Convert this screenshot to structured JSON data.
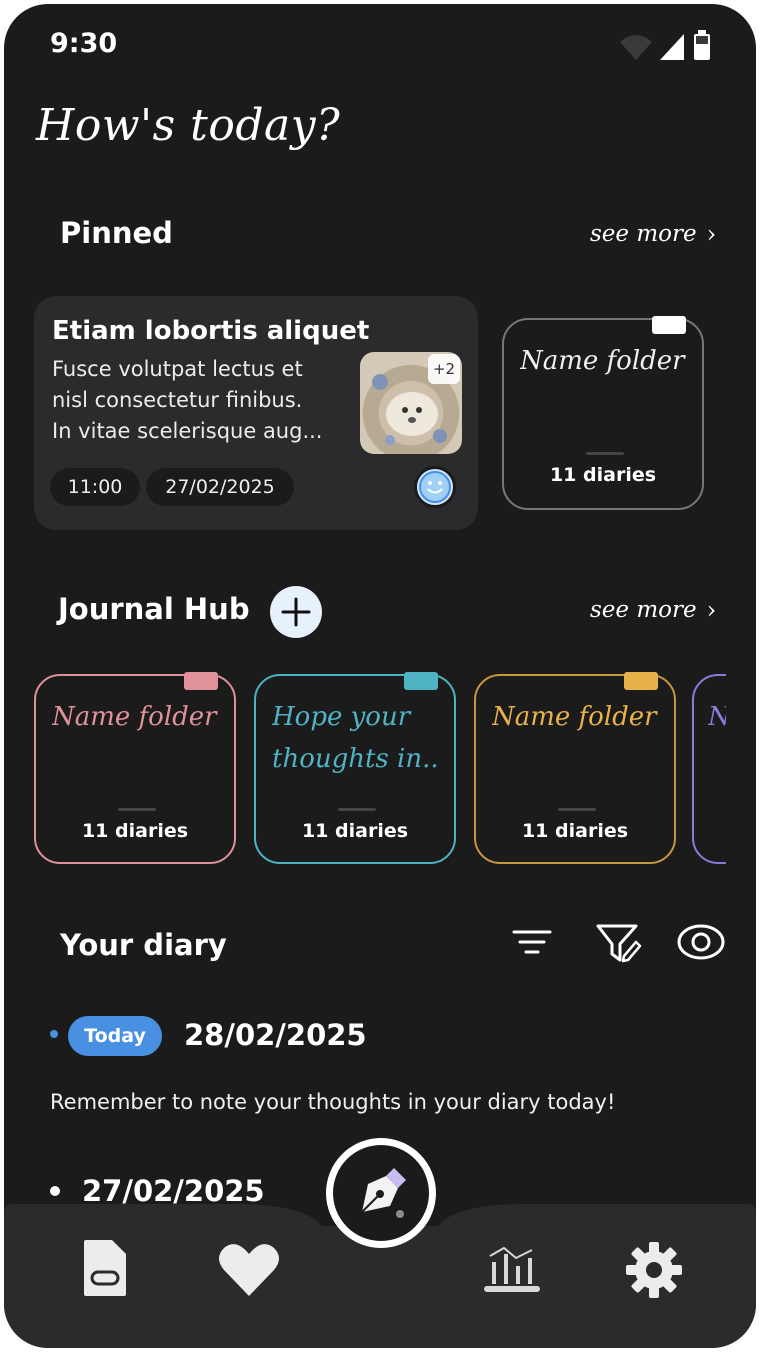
{
  "status_bar": {
    "time": "9:30"
  },
  "header": {
    "title": "How's today?"
  },
  "pinned": {
    "title": "Pinned",
    "see_more": "see more",
    "note": {
      "title": "Etiam lobortis aliquet",
      "lines": [
        "Fusce volutpat lectus et",
        "nisl consectetur finibus.",
        "In vitae scelerisque aug..."
      ],
      "time": "11:00",
      "date": "27/02/2025",
      "extra_photos": "+2"
    },
    "folder": {
      "name": "Name folder",
      "count": "11 diaries"
    }
  },
  "journal_hub": {
    "title": "Journal Hub",
    "see_more": "see more",
    "folders": [
      {
        "name_lines": [
          "Name folder"
        ],
        "count": "11 diaries",
        "color": "#e0919a"
      },
      {
        "name_lines": [
          "Hope your",
          "thoughts in.."
        ],
        "count": "11 diaries",
        "color": "#4fb3c4"
      },
      {
        "name_lines": [
          "Name folder"
        ],
        "count": "11 diaries",
        "color": "#e8b24a"
      },
      {
        "name_lines": [
          "N"
        ],
        "count": "",
        "color": "#8c7ad8"
      }
    ]
  },
  "your_diary": {
    "title": "Your diary",
    "entries": [
      {
        "badge": "Today",
        "date": "28/02/2025",
        "text": "Remember to note your thoughts in your diary today!"
      },
      {
        "date": "27/02/2025"
      }
    ]
  },
  "bottom_nav": {
    "items": [
      "document-icon",
      "heart-icon",
      "pen-nib-icon",
      "chart-icon",
      "gear-icon"
    ]
  }
}
